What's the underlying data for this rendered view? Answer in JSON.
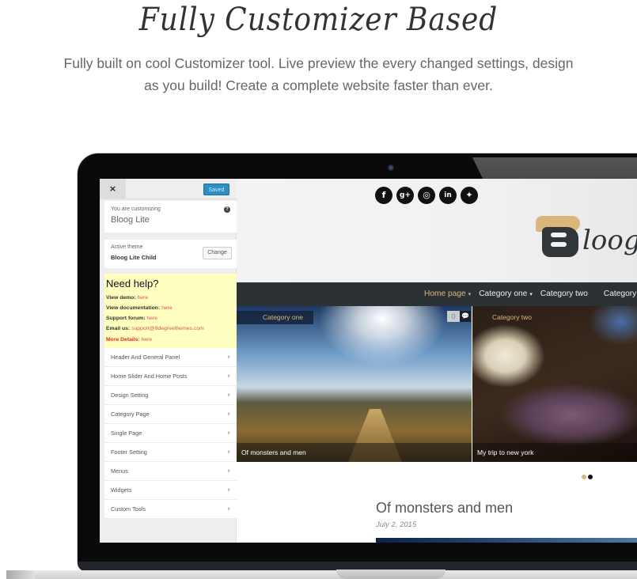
{
  "hero": {
    "title": "Fully Customizer Based",
    "subtitle_line1": "Fully built on cool Customizer tool. Live preview the every changed settings, design",
    "subtitle_line2": "as you build! Create a complete website faster than ever."
  },
  "customizer": {
    "close_label": "×",
    "saved_label": "Saved",
    "customizing_label": "You are customizing",
    "customizing_name": "Bloog Lite",
    "help_icon": "?",
    "active_theme_label": "Active theme",
    "active_theme_name": "Bloog Lite Child",
    "change_label": "Change",
    "help": {
      "heading": "Need help?",
      "lines": [
        {
          "label": "View demo:",
          "link": "here"
        },
        {
          "label": "View documentation:",
          "link": "here"
        },
        {
          "label": "Support forum:",
          "link": "here"
        },
        {
          "label": "Email us:",
          "link": "support@8degreethemes.com"
        },
        {
          "label": "More Details:",
          "link": "here"
        }
      ]
    },
    "panels": [
      "Header And General Panel",
      "Home Slider And Home Posts",
      "Design Setting",
      "Category Page",
      "Single Page",
      "Footer Setting",
      "Menus",
      "Widgets",
      "Custom Tools"
    ],
    "chevron": "›"
  },
  "preview": {
    "social_icons": [
      {
        "name": "facebook-icon",
        "glyph": "f"
      },
      {
        "name": "google-plus-icon",
        "glyph": "g+"
      },
      {
        "name": "instagram-icon",
        "glyph": "◎"
      },
      {
        "name": "linkedin-icon",
        "glyph": "in"
      },
      {
        "name": "twitter-icon",
        "glyph": "✦"
      }
    ],
    "logo_text": "loog",
    "nav": [
      {
        "label": "Home page",
        "caret": "▾",
        "active": true
      },
      {
        "label": "Category one",
        "caret": "▾",
        "active": false
      },
      {
        "label": "Category two",
        "caret": "",
        "active": false
      },
      {
        "label": "Category t",
        "caret": "",
        "active": false
      }
    ],
    "slides": [
      {
        "category": "Category one",
        "title": "Of monsters and men",
        "comments": "0",
        "comment_icon": "💬"
      },
      {
        "category": "Category two",
        "title": "My trip to new york"
      }
    ],
    "dots": {
      "active": "#d9b77b",
      "inactive": "#111111"
    },
    "post": {
      "title": "Of monsters and men",
      "date": "July 2, 2015"
    }
  },
  "colors": {
    "accent_gold": "#d9b77b",
    "saved_blue": "#2e8fc2",
    "help_bg": "#ffffc0",
    "nav_bg": "#2c3136",
    "link_red": "#d9534f"
  }
}
